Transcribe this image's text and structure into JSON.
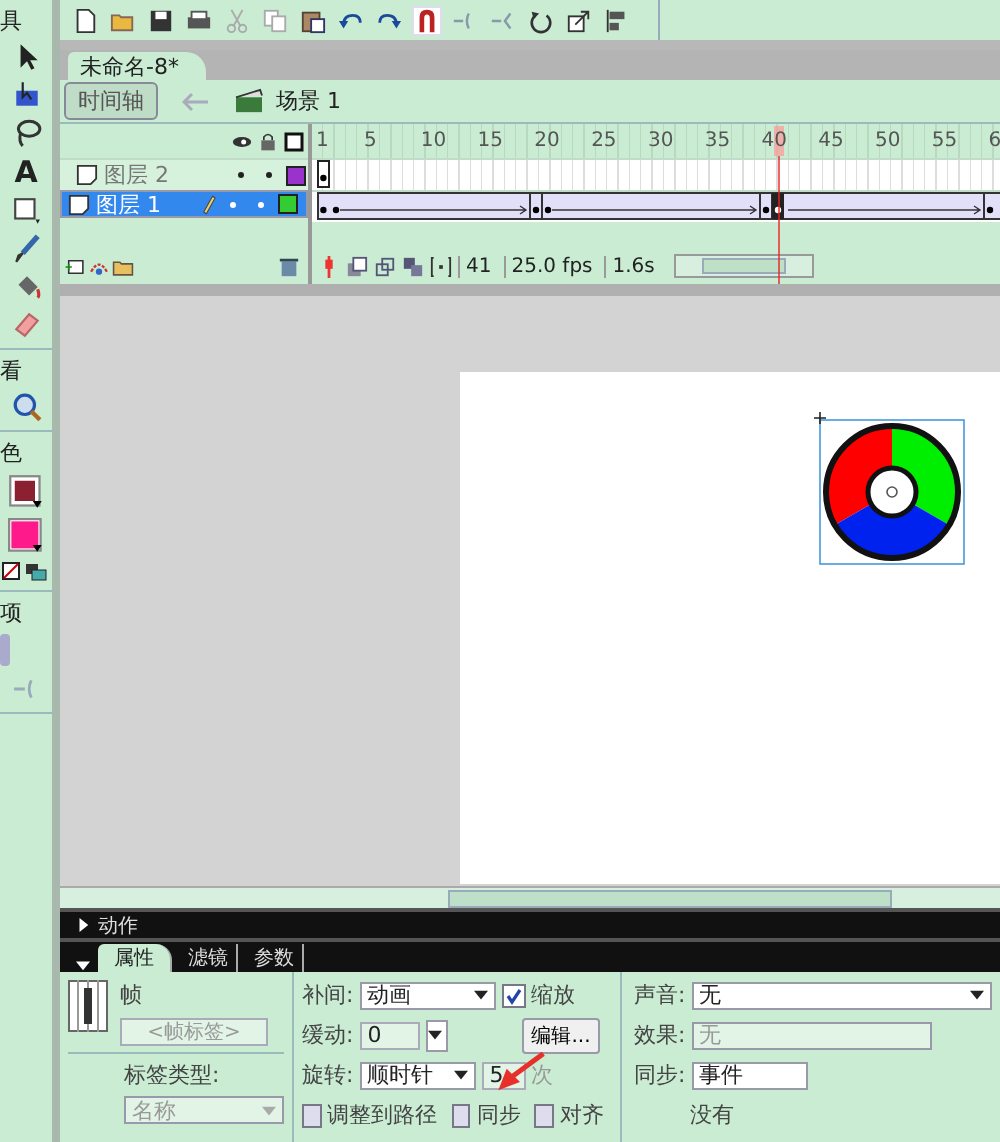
{
  "left_toolbar": {
    "tools_label": "具",
    "text_tool": "A",
    "view_label": "看",
    "color_label": "色",
    "options_label": "项"
  },
  "document_tab": "未命名-8*",
  "edit_bar": {
    "timeline_button": "时间轴",
    "scene": "场景 1"
  },
  "ruler": [
    "1",
    "5",
    "10",
    "15",
    "20",
    "25",
    "30",
    "35",
    "40",
    "45",
    "50",
    "55",
    "6"
  ],
  "layers": [
    {
      "name": "图层 2",
      "selected": false,
      "color": "#9933cc"
    },
    {
      "name": "图层 1",
      "selected": true,
      "color": "#33cc33"
    }
  ],
  "timeline_status": {
    "frame": "41",
    "fps": "25.0 fps",
    "time": "1.6s"
  },
  "actions_panel": {
    "title": "动作",
    "expanded": false
  },
  "property_tabs": [
    {
      "label": "属性",
      "selected": true
    },
    {
      "label": "滤镜",
      "selected": false
    },
    {
      "label": "参数",
      "selected": false
    }
  ],
  "properties": {
    "frame_label": "帧",
    "frame_name_placeholder": "<帧标签>",
    "label_type": "标签类型:",
    "label_type_value": "名称",
    "tween": {
      "label": "补间:",
      "value": "动画"
    },
    "scale": {
      "label": "缩放",
      "checked": true
    },
    "ease": {
      "label": "缓动:",
      "value": "0"
    },
    "edit_button": "编辑...",
    "rotate": {
      "label": "旋转:",
      "value": "顺时针"
    },
    "rotate_times": {
      "value": "5",
      "unit": "次"
    },
    "checkboxes": [
      {
        "label": "调整到路径",
        "checked": false
      },
      {
        "label": "同步",
        "checked": false
      },
      {
        "label": "对齐",
        "checked": false
      }
    ],
    "sound": {
      "label": "声音:",
      "value": "无"
    },
    "effect": {
      "label": "效果:",
      "value": "无",
      "disabled": true
    },
    "sound_sync": {
      "label": "同步:",
      "value": "事件"
    },
    "note": "没有"
  }
}
